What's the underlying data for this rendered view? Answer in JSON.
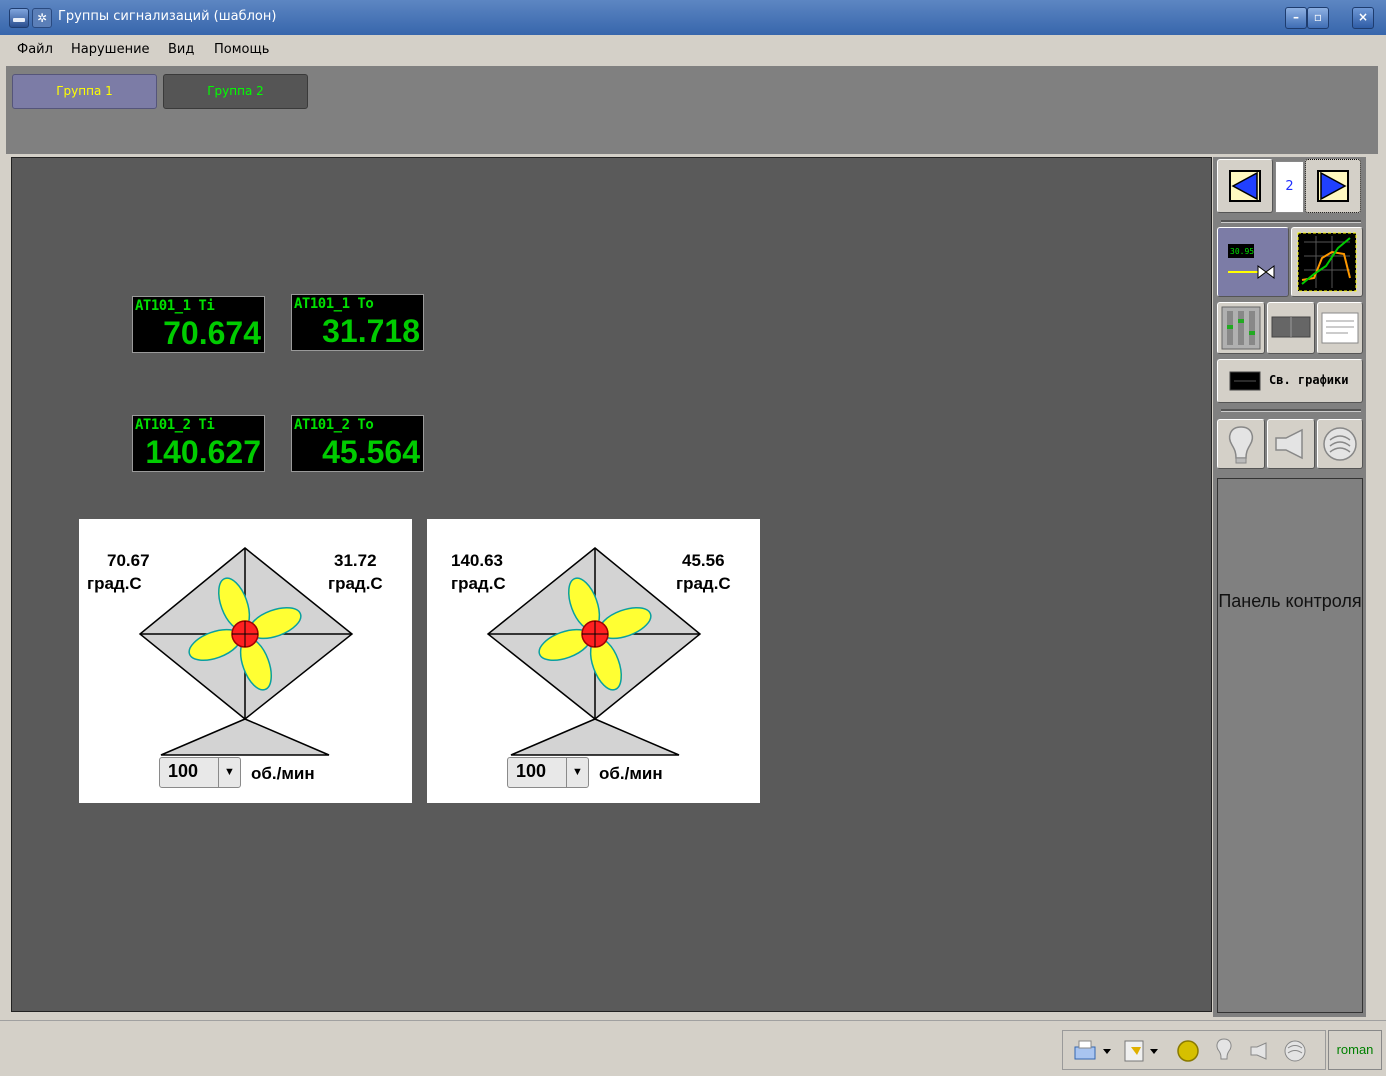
{
  "window": {
    "title": "Группы сигнализаций (шаблон)"
  },
  "menu": [
    "Файл",
    "Нарушение",
    "Вид",
    "Помощь"
  ],
  "tabs": [
    {
      "label": "Группа 1",
      "color": "#ffff00",
      "active": true
    },
    {
      "label": "Группа 2",
      "color": "#00ff00",
      "active": false
    }
  ],
  "readouts": [
    {
      "label": "AT101_1 Ti",
      "value": "70.674"
    },
    {
      "label": "AT101_1 To",
      "value": "31.718"
    },
    {
      "label": "AT101_2 Ti",
      "value": "140.627"
    },
    {
      "label": "AT101_2 To",
      "value": "45.564"
    }
  ],
  "fans": [
    {
      "temp_in": "70.67",
      "temp_out": "31.72",
      "unit": "град.С",
      "speed": "100",
      "speed_unit": "об./мин"
    },
    {
      "temp_in": "140.63",
      "temp_out": "45.56",
      "unit": "град.С",
      "speed": "100",
      "speed_unit": "об./мин"
    }
  ],
  "sidebar": {
    "page_number": "2",
    "charts_label": "Св. графики",
    "control_panel_label": "Панель контроля"
  },
  "status": {
    "user": "roman"
  },
  "colors": {
    "canvas": "#5a5a5a",
    "readout_text": "#00cc00",
    "fan_blade": "#ffff33",
    "fan_hub": "#ff2020"
  }
}
